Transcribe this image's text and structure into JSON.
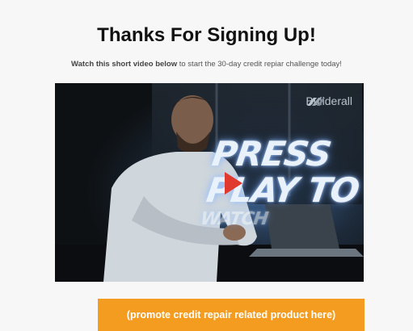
{
  "header": {
    "title": "Thanks For Signing Up!",
    "subtitle_bold": "Watch this short video below",
    "subtitle_rest": " to start the 30-day credit repiar challenge today!"
  },
  "video": {
    "brand": "Builderall",
    "overlay_line1": "PRESS",
    "overlay_line2": "PLAY TO",
    "overlay_line3": "WATCH",
    "play_icon": "play-icon",
    "colors": {
      "play": "#e03a2f",
      "background": "#141618"
    }
  },
  "cta": {
    "label": "(promote credit repair related product here)",
    "color": "#f39c1f"
  }
}
